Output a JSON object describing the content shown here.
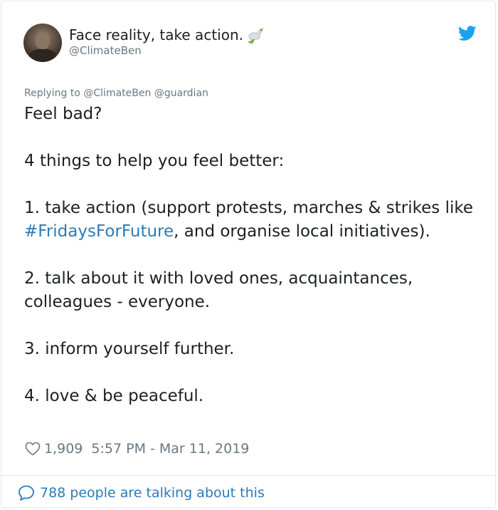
{
  "tweet": {
    "display_name": "Face reality, take action.",
    "handle": "@ClimateBen",
    "reply_prefix": "Replying to ",
    "reply_to_1": "@ClimateBen",
    "reply_to_2": "@guardian",
    "lines": {
      "p1": "Feel bad?",
      "p2": "4 things to help you feel better:",
      "p3_before": "1. take action (support protests, marches & strikes like ",
      "p3_hashtag": "#FridaysForFuture",
      "p3_after": ", and organise local initiatives).",
      "p4": "2. talk about it with loved ones, acquaintances, colleagues - everyone.",
      "p5": "3. inform yourself further.",
      "p6": "4. love & be peaceful."
    },
    "likes": "1,909",
    "timestamp": "5:57 PM - Mar 11, 2019",
    "talking": "788 people are talking about this"
  },
  "icons": {
    "brand": "twitter-bird-icon",
    "name_emoji": "dove-icon",
    "like": "heart-icon",
    "conversation": "speech-bubble-icon"
  },
  "colors": {
    "link": "#2b7bb9",
    "secondary": "#697882",
    "text": "#1c2022",
    "twitter_blue": "#1da1f2",
    "border": "#e1e8ed"
  }
}
